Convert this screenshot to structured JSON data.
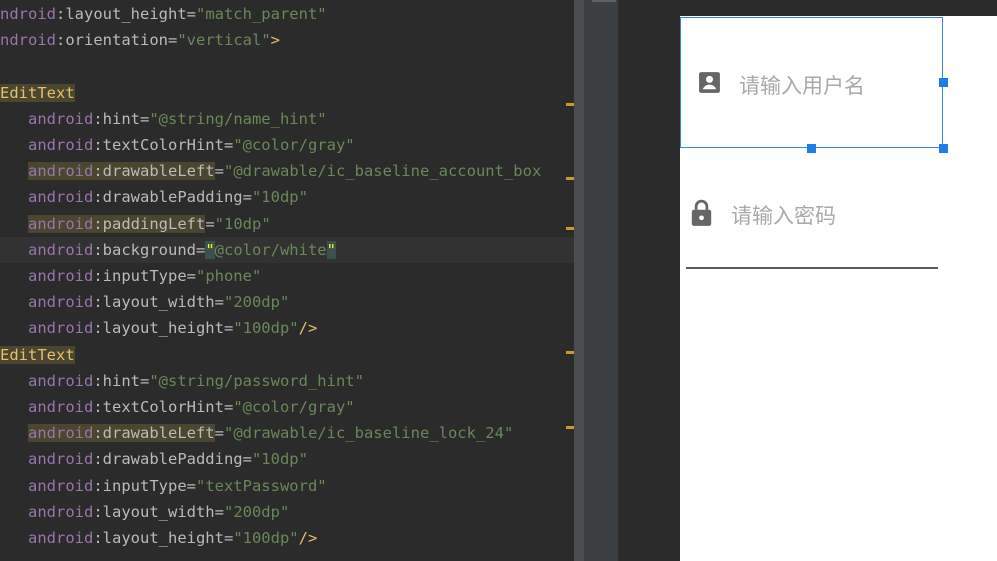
{
  "code_lines": [
    [
      {
        "t": "ndroid",
        "c": "ns"
      },
      {
        "t": ":layout_height=",
        "c": "attr"
      },
      {
        "t": "\"match_parent\"",
        "c": "val"
      }
    ],
    [
      {
        "t": "ndroid",
        "c": "ns"
      },
      {
        "t": ":orientation=",
        "c": "attr"
      },
      {
        "t": "\"vertical\"",
        "c": "val"
      },
      {
        "t": ">",
        "c": "tag"
      }
    ],
    [],
    [
      {
        "t": "EditText",
        "c": "tag hl-tag"
      }
    ],
    [
      {
        "t": "   android",
        "c": "ns"
      },
      {
        "t": ":hint=",
        "c": "attr"
      },
      {
        "t": "\"@string/name_hint\"",
        "c": "val"
      }
    ],
    [
      {
        "t": "   android",
        "c": "ns"
      },
      {
        "t": ":textColorHint=",
        "c": "attr"
      },
      {
        "t": "\"@color/gray\"",
        "c": "val"
      }
    ],
    [
      {
        "t": "   "
      },
      {
        "t": "android",
        "c": "ns hl-ns"
      },
      {
        "t": ":drawableLeft",
        "c": "attr hl-ns"
      },
      {
        "t": "=",
        "c": "attr"
      },
      {
        "t": "\"@drawable/ic_baseline_account_box",
        "c": "val"
      }
    ],
    [
      {
        "t": "   android",
        "c": "ns"
      },
      {
        "t": ":drawablePadding=",
        "c": "attr"
      },
      {
        "t": "\"10dp\"",
        "c": "val"
      }
    ],
    [
      {
        "t": "   "
      },
      {
        "t": "android",
        "c": "ns hl-ns"
      },
      {
        "t": ":paddingLeft",
        "c": "attr hl-ns"
      },
      {
        "t": "=",
        "c": "attr"
      },
      {
        "t": "\"10dp\"",
        "c": "val"
      }
    ],
    [
      {
        "t": "   android",
        "c": "ns"
      },
      {
        "t": ":background=",
        "c": "attr"
      },
      {
        "t": "\"",
        "c": "caret-q"
      },
      {
        "t": "@color/white",
        "c": "val"
      },
      {
        "t": "\"",
        "c": "caret-q"
      }
    ],
    [
      {
        "t": "   android",
        "c": "ns"
      },
      {
        "t": ":inputType=",
        "c": "attr"
      },
      {
        "t": "\"phone\"",
        "c": "val"
      }
    ],
    [
      {
        "t": "   android",
        "c": "ns"
      },
      {
        "t": ":layout_width=",
        "c": "attr"
      },
      {
        "t": "\"200dp\"",
        "c": "val"
      }
    ],
    [
      {
        "t": "   android",
        "c": "ns"
      },
      {
        "t": ":layout_height=",
        "c": "attr"
      },
      {
        "t": "\"100dp\"",
        "c": "val"
      },
      {
        "t": "/>",
        "c": "tag"
      }
    ],
    [
      {
        "t": "EditText",
        "c": "tag hl-tag"
      }
    ],
    [
      {
        "t": "   android",
        "c": "ns"
      },
      {
        "t": ":hint=",
        "c": "attr"
      },
      {
        "t": "\"@string/password_hint\"",
        "c": "val"
      }
    ],
    [
      {
        "t": "   android",
        "c": "ns"
      },
      {
        "t": ":textColorHint=",
        "c": "attr"
      },
      {
        "t": "\"@color/gray\"",
        "c": "val"
      }
    ],
    [
      {
        "t": "   "
      },
      {
        "t": "android",
        "c": "ns hl-ns"
      },
      {
        "t": ":drawableLeft",
        "c": "attr hl-ns"
      },
      {
        "t": "=",
        "c": "attr"
      },
      {
        "t": "\"@drawable/ic_baseline_lock_24\"",
        "c": "val"
      }
    ],
    [
      {
        "t": "   android",
        "c": "ns"
      },
      {
        "t": ":drawablePadding=",
        "c": "attr"
      },
      {
        "t": "\"10dp\"",
        "c": "val"
      }
    ],
    [
      {
        "t": "   android",
        "c": "ns"
      },
      {
        "t": ":inputType=",
        "c": "attr"
      },
      {
        "t": "\"textPassword\"",
        "c": "val"
      }
    ],
    [
      {
        "t": "   android",
        "c": "ns"
      },
      {
        "t": ":layout_width=",
        "c": "attr"
      },
      {
        "t": "\"200dp\"",
        "c": "val"
      }
    ],
    [
      {
        "t": "   android",
        "c": "ns"
      },
      {
        "t": ":layout_height=",
        "c": "attr"
      },
      {
        "t": "\"100dp\"",
        "c": "val"
      },
      {
        "t": "/>",
        "c": "tag"
      }
    ]
  ],
  "preview": {
    "username_hint": "请输入用户名",
    "password_hint": "请输入密码",
    "username_icon": "account-box-icon",
    "password_icon": "lock-icon"
  },
  "colors": {
    "editor_bg": "#2b2b2b",
    "keyword": "#9876aa",
    "string": "#6a8759",
    "tag": "#e8bf6a",
    "selection": "#2f88ee",
    "hint": "#a9a9a9"
  }
}
